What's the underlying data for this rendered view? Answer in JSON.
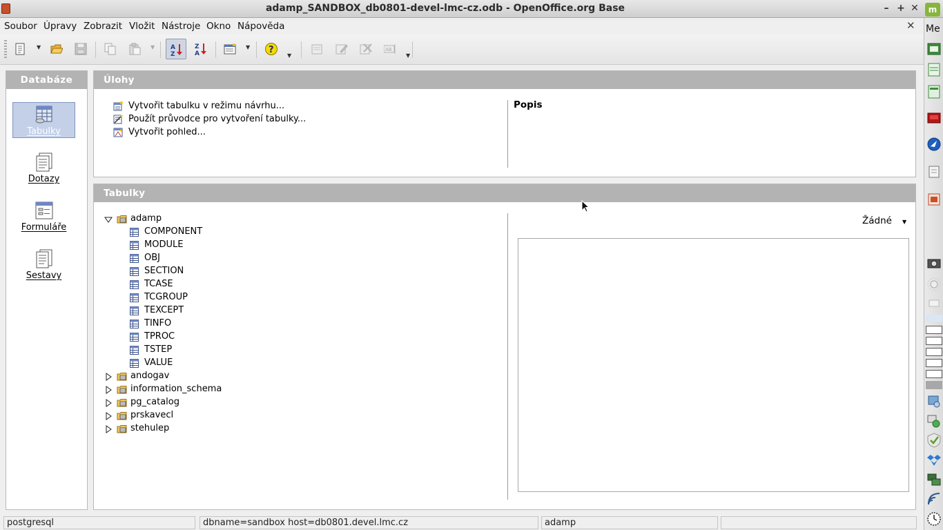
{
  "window": {
    "title": "adamp_SANDBOX_db0801-devel-lmc-cz.odb - OpenOffice.org Base",
    "minimize": "–",
    "maximize": "+",
    "close": "✕"
  },
  "menu": {
    "items": [
      "Soubor",
      "Úpravy",
      "Zobrazit",
      "Vložit",
      "Nástroje",
      "Okno",
      "Nápověda"
    ],
    "close_doc": "✕"
  },
  "toolbar": {
    "icons": [
      "new-document-icon",
      "open-folder-icon",
      "save-icon",
      "copy-icon",
      "paste-icon",
      "sort-ascending-icon",
      "sort-descending-icon",
      "form-wizard-icon",
      "help-icon",
      "open-object-icon",
      "edit-icon",
      "delete-icon",
      "rename-icon"
    ]
  },
  "database_panel": {
    "header": "Databáze",
    "items": [
      {
        "label": "Tabulky",
        "selected": true
      },
      {
        "label": "Dotazy",
        "selected": false
      },
      {
        "label": "Formuláře",
        "selected": false
      },
      {
        "label": "Sestavy",
        "selected": false
      }
    ]
  },
  "tasks_panel": {
    "header": "Úlohy",
    "tasks": [
      "Vytvořit tabulku v režimu návrhu...",
      "Použít průvodce pro vytvoření tabulky...",
      "Vytvořit pohled..."
    ],
    "description_label": "Popis"
  },
  "tables_panel": {
    "header": "Tabulky",
    "tree": [
      {
        "name": "adamp",
        "expanded": true,
        "tables": [
          "COMPONENT",
          "MODULE",
          "OBJ",
          "SECTION",
          "TCASE",
          "TCGROUP",
          "TEXCEPT",
          "TINFO",
          "TPROC",
          "TSTEP",
          "VALUE"
        ]
      },
      {
        "name": "andogav",
        "expanded": false
      },
      {
        "name": "information_schema",
        "expanded": false
      },
      {
        "name": "pg_catalog",
        "expanded": false
      },
      {
        "name": "prskavecl",
        "expanded": false
      },
      {
        "name": "stehulep",
        "expanded": false
      }
    ],
    "preview_mode": "Žádné"
  },
  "statusbar": {
    "fields": [
      "postgresql",
      "dbname=sandbox host=db0801.devel.lmc.cz",
      "adamp",
      ""
    ]
  },
  "dock": {
    "top_label": "Me",
    "mint_label": "m"
  },
  "colors": {
    "panel_header": "#b3b3b3",
    "selection": "#c3d0e8",
    "background": "#efefef"
  }
}
